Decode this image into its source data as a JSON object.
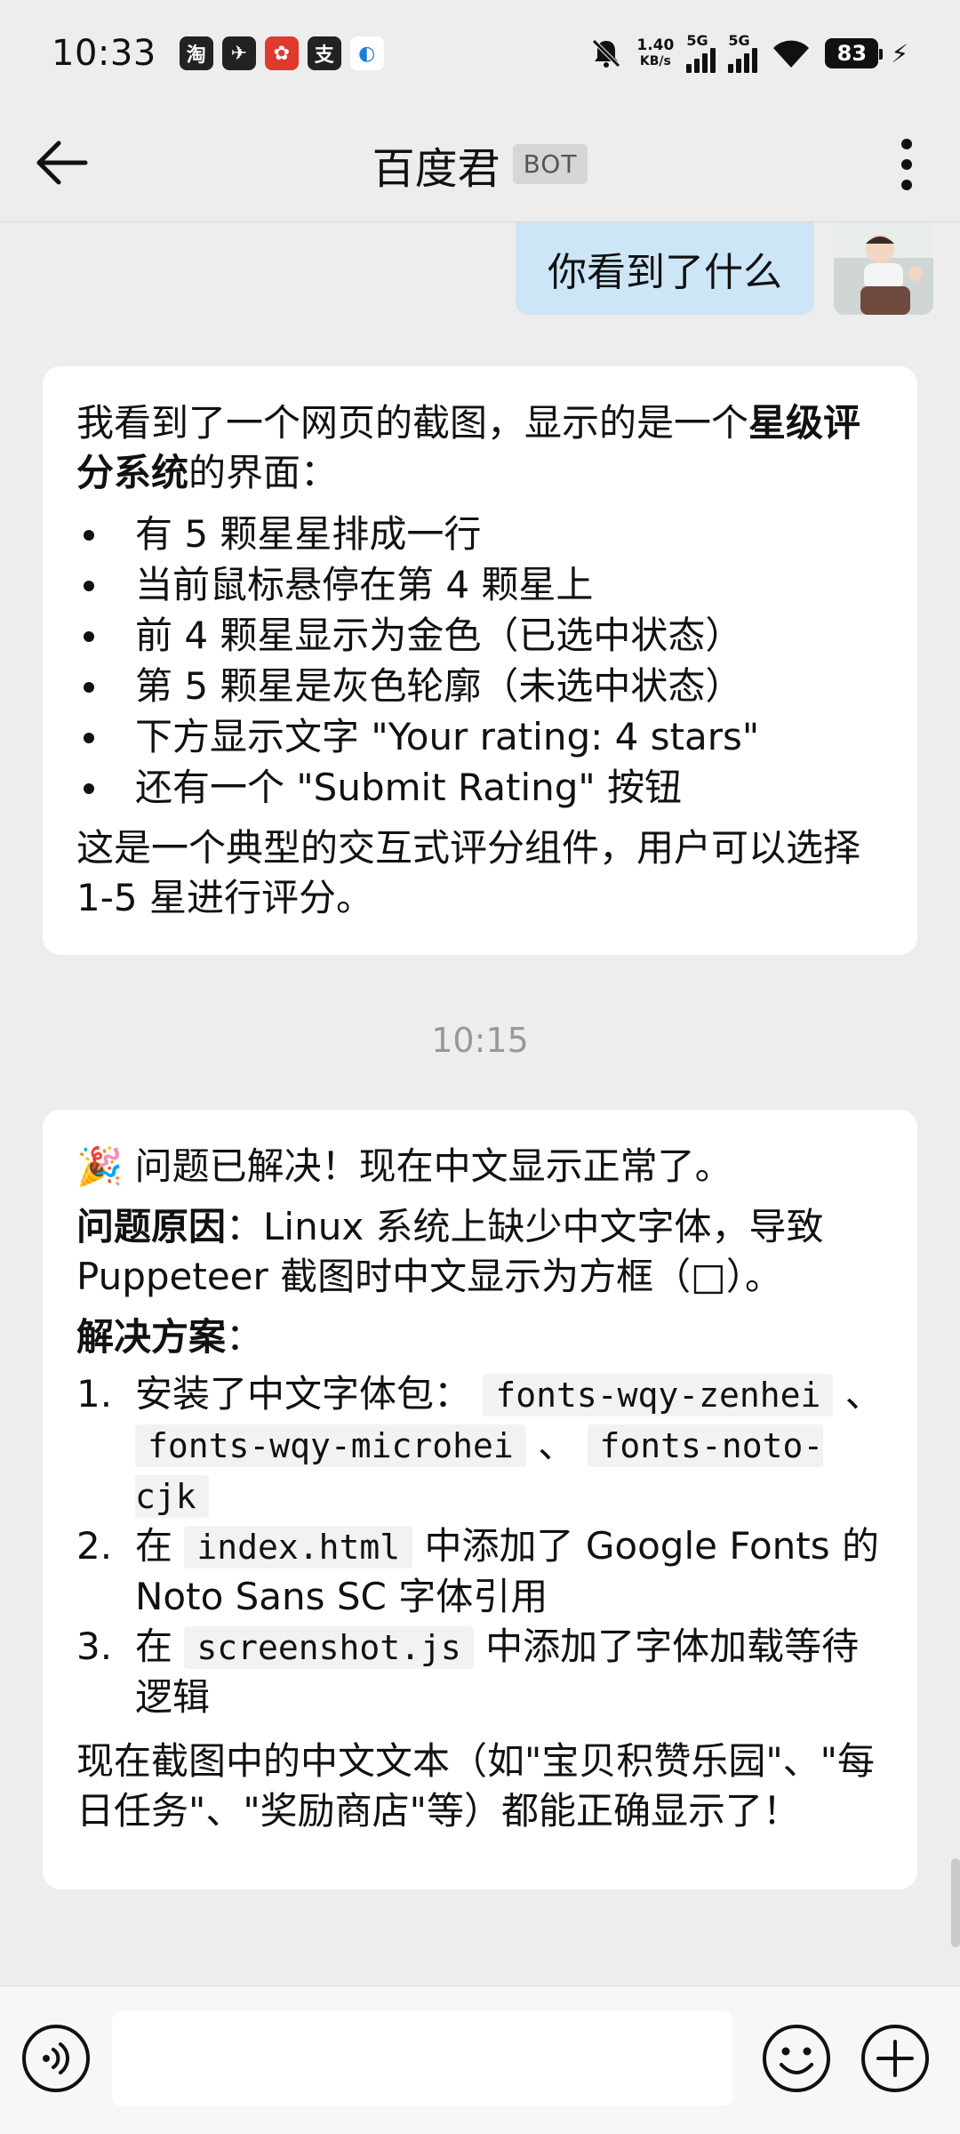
{
  "status_bar": {
    "time": "10:33",
    "app_icons": [
      "淘",
      "✈",
      "✿",
      "支",
      "◐"
    ],
    "net_speed_value": "1.40",
    "net_speed_unit": "KB/s",
    "sim1_label": "5G",
    "sim2_label": "5G",
    "battery": "83",
    "bolt": "⚡"
  },
  "header": {
    "title": "百度君",
    "badge": "BOT"
  },
  "user_message": {
    "text": "你看到了什么"
  },
  "bot_reply_1": {
    "intro_1": "我看到了一个网页的截图，显示的是一个",
    "intro_bold": "星级评分系统",
    "intro_2": "的界面：",
    "items": [
      "有 5 颗星星排成一行",
      "当前鼠标悬停在第 4 颗星上",
      "前 4 颗星显示为金色（已选中状态）",
      "第 5 颗星是灰色轮廓（未选中状态）",
      "下方显示文字 \"Your rating: 4 stars\"",
      "还有一个 \"Submit Rating\" 按钮"
    ],
    "outro": "这是一个典型的交互式评分组件，用户可以选择1-5 星进行评分。"
  },
  "timestamp": "10:15",
  "bot_reply_2": {
    "party_emoji": "🎉",
    "headline": "问题已解决！现在中文显示正常了。",
    "cause_label": "问题原因",
    "cause_text": "：Linux 系统上缺少中文字体，导致 Puppeteer 截图时中文显示为方框（□）。",
    "solution_label": "解决方案",
    "solution_colon": "：",
    "steps": {
      "s1_num": "1.",
      "s1_text": "安装了中文字体包：",
      "s1_code1": "fonts-wqy-zenhei",
      "s1_sep1": "、",
      "s1_code2": "fonts-wqy-microhei",
      "s1_sep2": "、",
      "s1_code3": "fonts-noto-cjk",
      "s2_num": "2.",
      "s2_pre": "在",
      "s2_code": "index.html",
      "s2_post": "中添加了 Google Fonts 的 Noto Sans SC 字体引用",
      "s3_num": "3.",
      "s3_pre": "在",
      "s3_code": "screenshot.js",
      "s3_post": "中添加了字体加载等待逻辑"
    },
    "outro": "现在截图中的中文文本（如\"宝贝积赞乐园\"、\"每日任务\"、\"奖励商店\"等）都能正确显示了！"
  },
  "input_bar": {
    "placeholder": ""
  }
}
